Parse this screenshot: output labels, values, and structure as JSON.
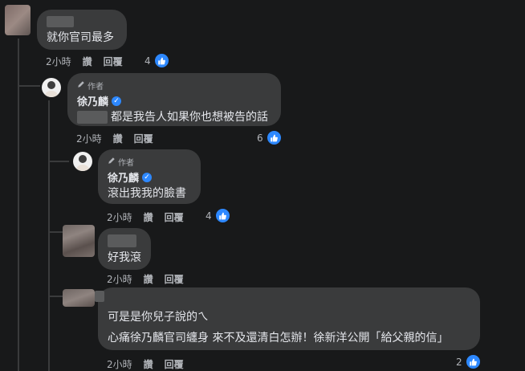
{
  "comments": [
    {
      "text": "就你官司最多",
      "time": "2小時",
      "like_btn": "讚",
      "reply_btn": "回覆",
      "likes": "4"
    },
    {
      "author_badge": "作者",
      "author": "徐乃麟",
      "text": "都是我告人如果你也想被告的話",
      "time": "2小時",
      "like_btn": "讚",
      "reply_btn": "回覆",
      "likes": "6"
    },
    {
      "author_badge": "作者",
      "author": "徐乃麟",
      "text": "滾出我我的臉書",
      "time": "2小時",
      "like_btn": "讚",
      "reply_btn": "回覆",
      "likes": "4"
    },
    {
      "text": "好我滾",
      "time": "2小時",
      "like_btn": "讚",
      "reply_btn": "回覆"
    },
    {
      "text": "可是是你兒子說的ㄟ",
      "text2": "心痛徐乃麟官司纏身 來不及還清白怎辦！徐新洋公開「給父親的信」",
      "time": "2小時",
      "like_btn": "讚",
      "reply_btn": "回覆",
      "likes": "2"
    }
  ],
  "icons": {
    "like": "thumbs-up-icon",
    "verified": "verified-badge-icon",
    "author": "pencil-icon"
  },
  "colors": {
    "background": "#18191a",
    "bubble": "#3a3b3c",
    "like_blue": "#2d88ff",
    "text": "#e4e6eb",
    "meta": "#b0b3b8"
  }
}
